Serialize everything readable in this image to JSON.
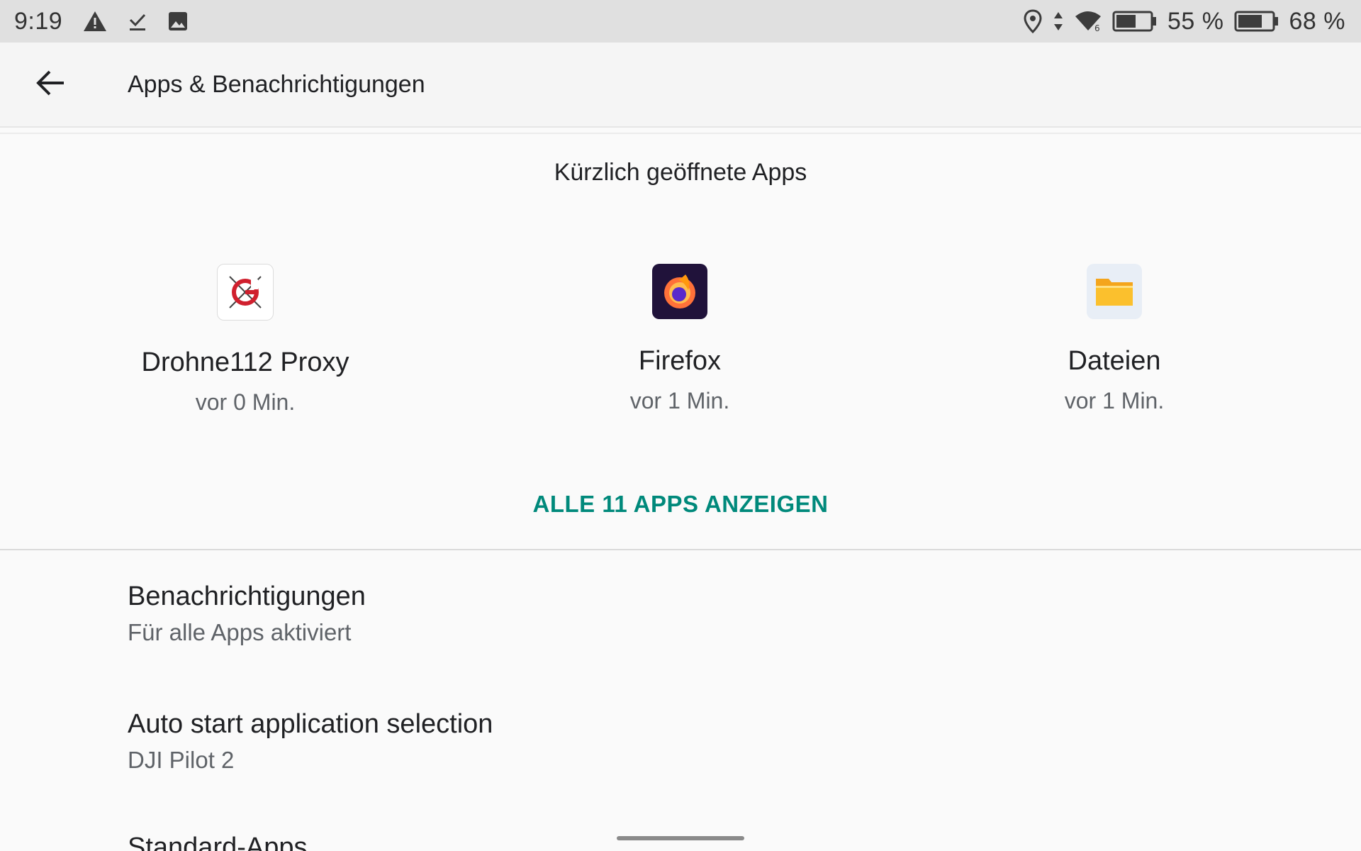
{
  "status_bar": {
    "time": "9:19",
    "battery_1": "55 %",
    "battery_1_level": 0.55,
    "battery_2": "68 %",
    "battery_2_level": 0.68,
    "left_icons": [
      "warning-icon",
      "download-done-icon",
      "image-icon"
    ],
    "right_icons": [
      "location-icon",
      "data-arrows-icon",
      "wifi-icon",
      "battery-icon",
      "battery-icon"
    ]
  },
  "app_bar": {
    "title": "Apps & Benachrichtigungen",
    "back_icon": "arrow-back-icon"
  },
  "recent": {
    "header": "Kürzlich geöffnete Apps",
    "apps": [
      {
        "name": "Drohne112 Proxy",
        "time": "vor 0 Min.",
        "icon": "drohne112-icon"
      },
      {
        "name": "Firefox",
        "time": "vor 1 Min.",
        "icon": "firefox-icon"
      },
      {
        "name": "Dateien",
        "time": "vor 1 Min.",
        "icon": "files-icon"
      }
    ],
    "see_all": "ALLE 11 APPS ANZEIGEN"
  },
  "prefs": [
    {
      "title": "Benachrichtigungen",
      "summary": "Für alle Apps aktiviert"
    },
    {
      "title": "Auto start application selection",
      "summary": "DJI Pilot 2"
    },
    {
      "title": "Standard-Apps",
      "summary": ""
    }
  ],
  "colors": {
    "accent": "#00897b",
    "status_bar_bg": "#e0e0e0",
    "app_bar_bg": "#f5f5f5",
    "background": "#fafafa"
  }
}
